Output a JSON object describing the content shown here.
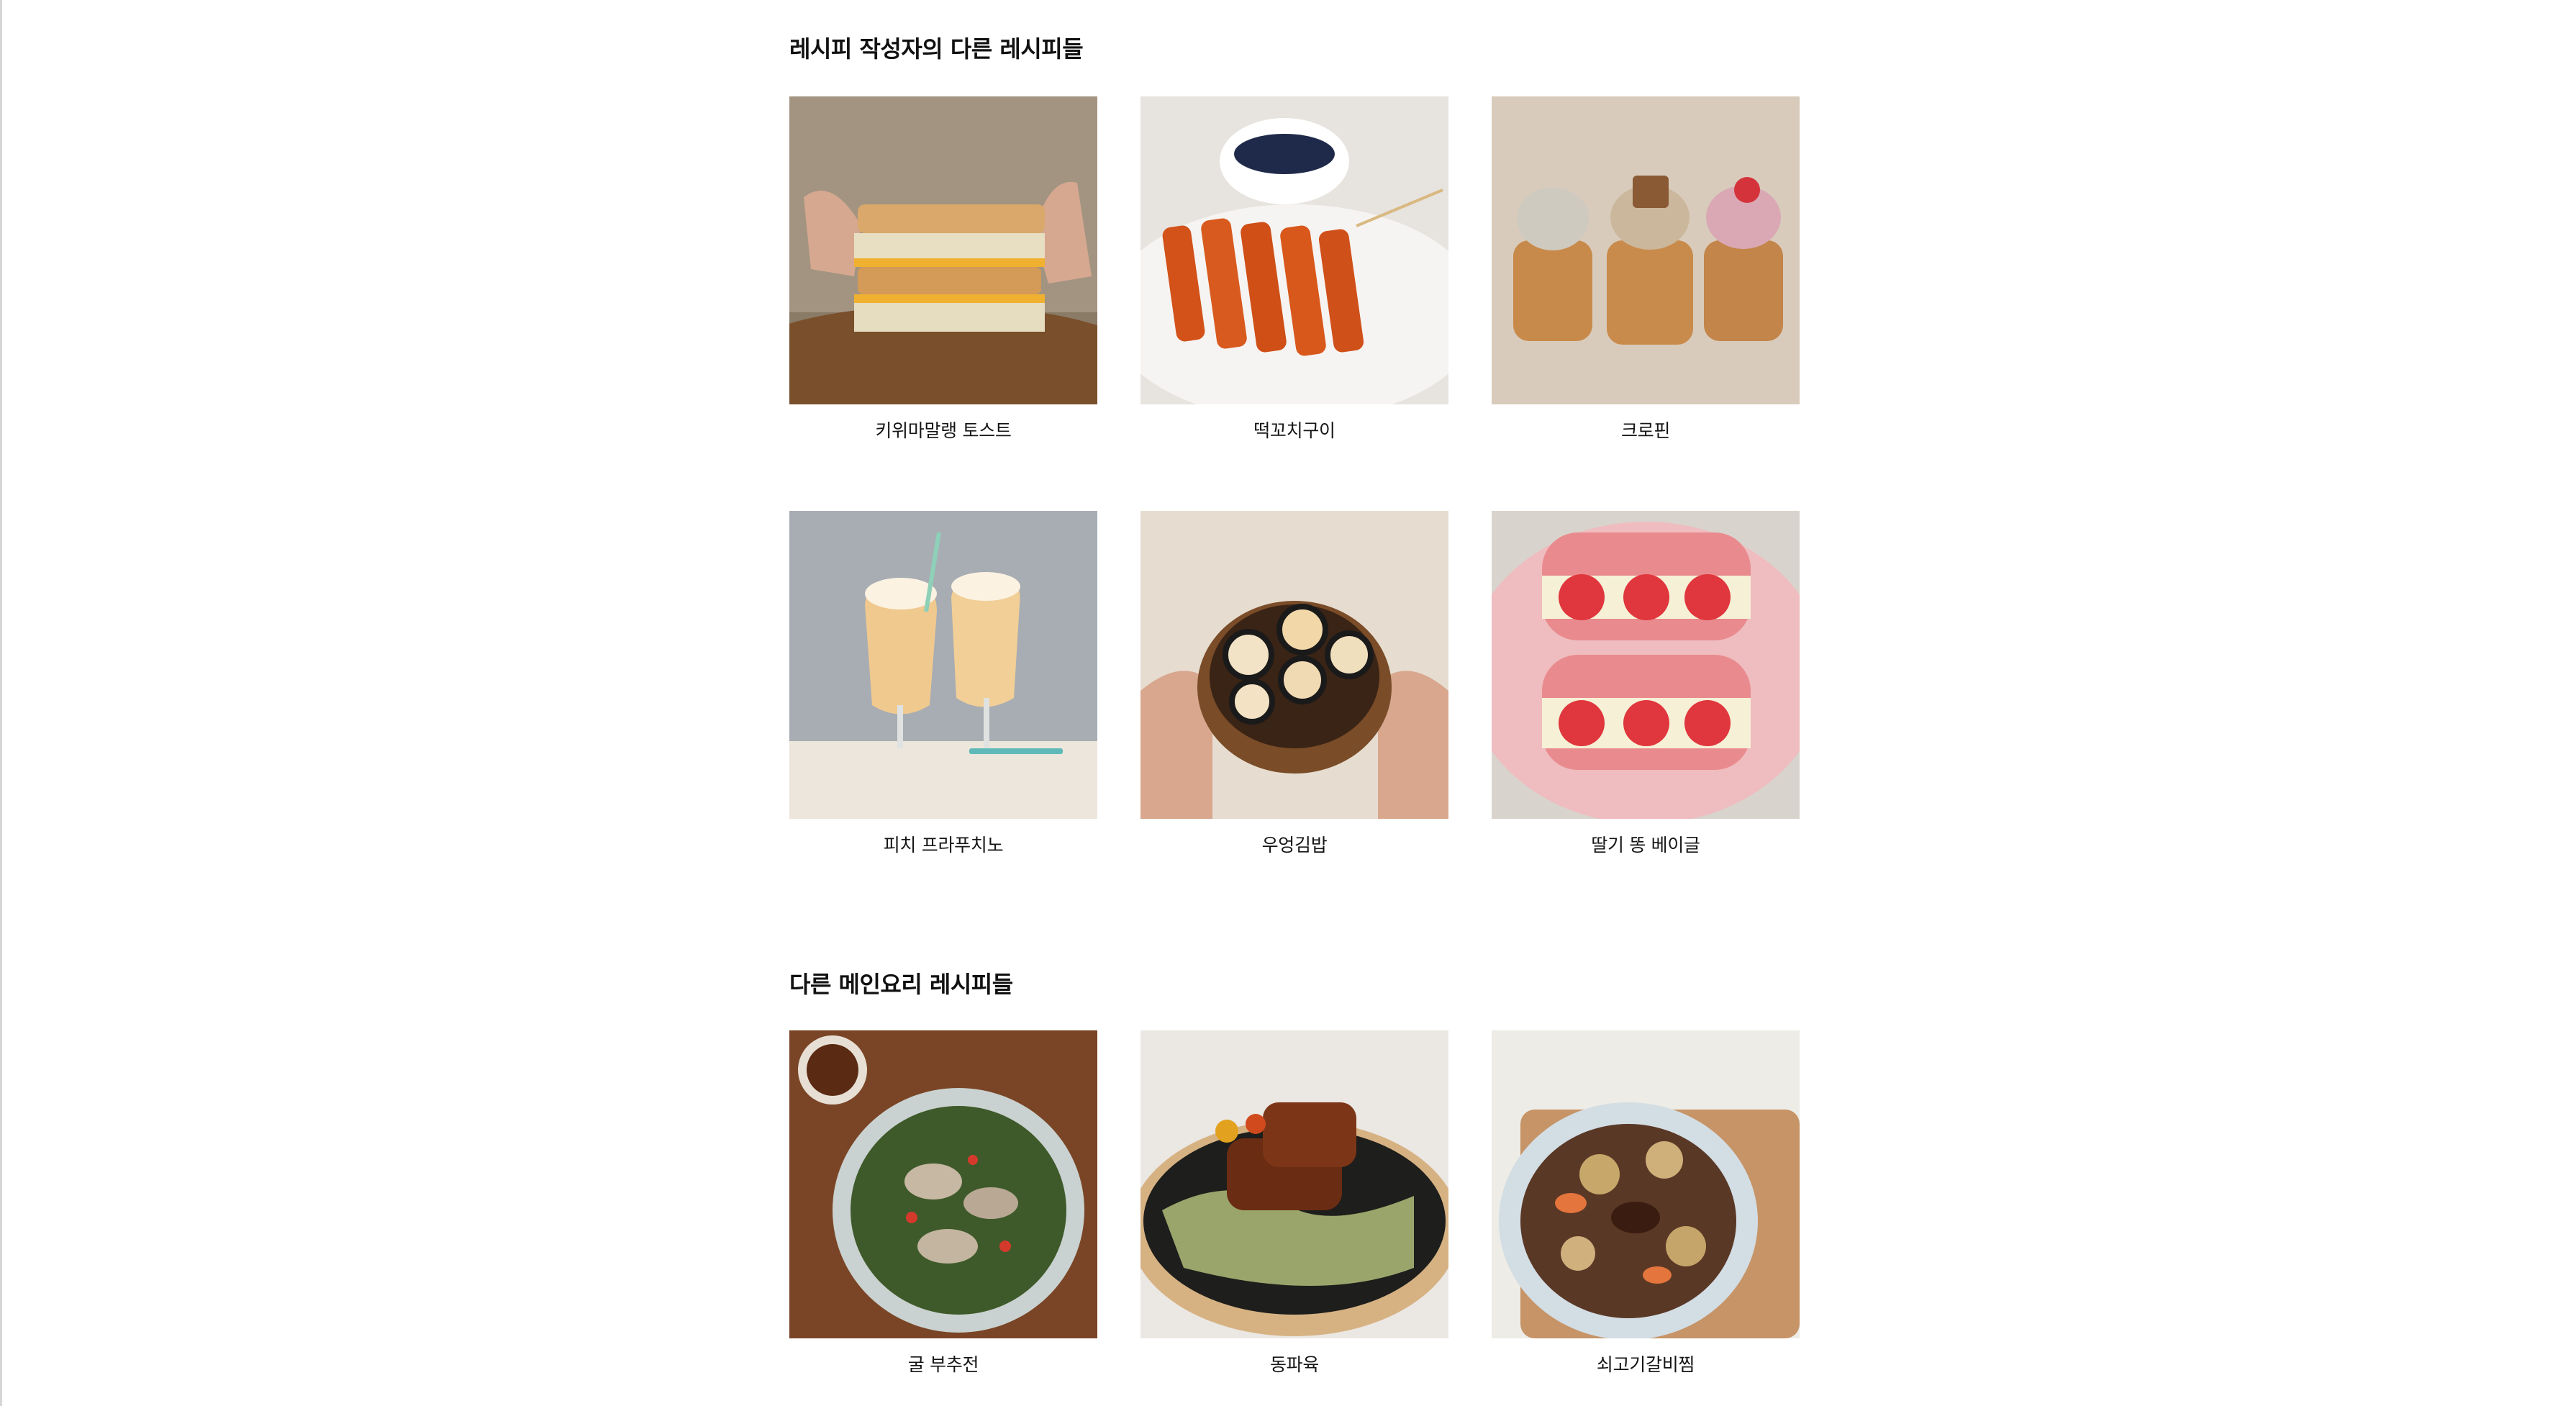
{
  "sections": [
    {
      "title": "레시피 작성자의 다른 레시피들",
      "items": [
        {
          "label": "키위마말랭 토스트",
          "image": "toast-sandwich-photo"
        },
        {
          "label": "떡꼬치구이",
          "image": "tteok-skewer-photo"
        },
        {
          "label": "크로핀",
          "image": "cruffin-photo"
        },
        {
          "label": "피치 프라푸치노",
          "image": "peach-frappuccino-photo"
        },
        {
          "label": "우엉김밥",
          "image": "burdock-kimbap-photo"
        },
        {
          "label": "딸기 똥 베이글",
          "image": "strawberry-bagel-photo"
        }
      ]
    },
    {
      "title": "다른 메인요리 레시피들",
      "items": [
        {
          "label": "굴 부추전",
          "image": "oyster-chive-pancake-photo"
        },
        {
          "label": "동파육",
          "image": "dongpo-pork-photo"
        },
        {
          "label": "쇠고기갈비찜",
          "image": "braised-short-rib-photo"
        }
      ]
    }
  ]
}
